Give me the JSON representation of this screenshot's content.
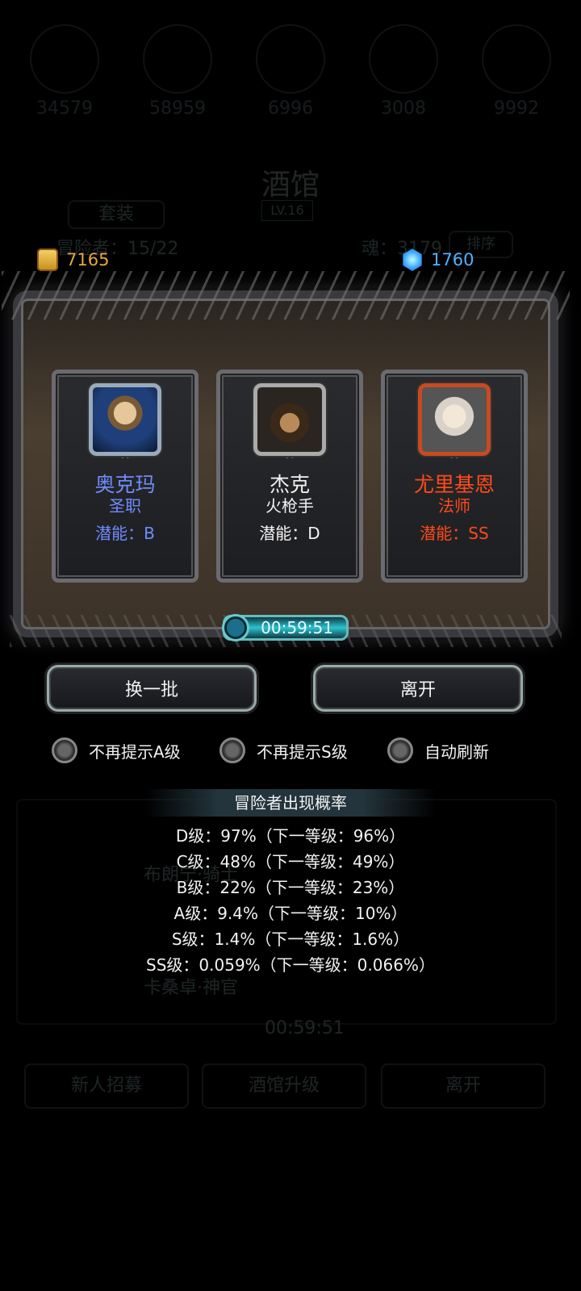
{
  "resources": {
    "gold": {
      "icon": "gold-coins-icon",
      "value": "7165"
    },
    "gems": {
      "icon": "blue-gem-icon",
      "value": "1760"
    }
  },
  "background": {
    "resources": [
      "34579",
      "58959",
      "6996",
      "3008",
      "9992"
    ],
    "title": "酒馆",
    "level": "LV.16",
    "suit_button": "套装",
    "adventurers": "冒险者：15/22",
    "soul": "魂：3179",
    "sort_button": "排序",
    "timer": "00:59:51",
    "bottom_buttons": [
      "新人招募",
      "酒馆升级",
      "离开"
    ],
    "list_names": [
      "布朗宁·骑士",
      "卡桑卓·神官"
    ]
  },
  "cards": [
    {
      "name": "奥克玛",
      "job": "圣职",
      "potential": "潜能：B",
      "color": "#6f8cff"
    },
    {
      "name": "杰克",
      "job": "火枪手",
      "potential": "潜能：D",
      "color": "#f2f2f2"
    },
    {
      "name": "尤里基恩",
      "job": "法师",
      "potential": "潜能：SS",
      "color": "#ff4a1a"
    }
  ],
  "timer": "00:59:51",
  "buttons": {
    "refresh": "换一批",
    "leave": "离开"
  },
  "options": [
    "不再提示A级",
    "不再提示S级",
    "自动刷新"
  ],
  "probability": {
    "title": "冒险者出现概率",
    "lines": [
      "D级：97%（下一等级：96%）",
      "C级：48%（下一等级：49%）",
      "B级：22%（下一等级：23%）",
      "A级：9.4%（下一等级：10%）",
      "S级：1.4%（下一等级：1.6%）",
      "SS级：0.059%（下一等级：0.066%）"
    ]
  }
}
